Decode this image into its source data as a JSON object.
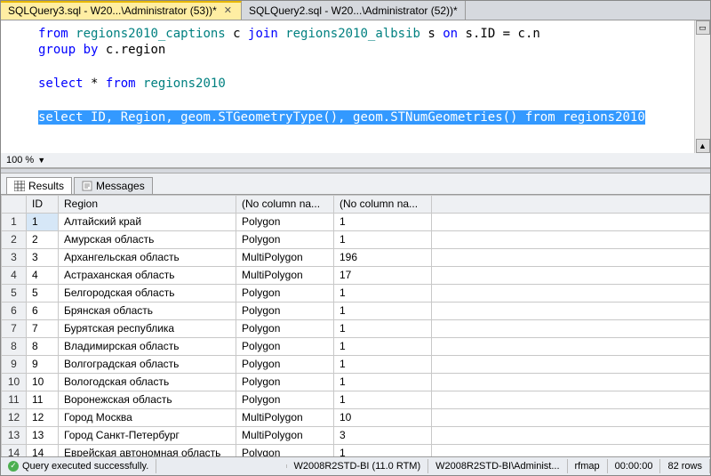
{
  "tabs": [
    {
      "label": "SQLQuery3.sql - W20...\\Administrator (53))*",
      "active": true
    },
    {
      "label": "SQLQuery2.sql - W20...\\Administrator (52))*",
      "active": false
    }
  ],
  "editor": {
    "line1_from": "from",
    "line1_t1": "regions2010_captions",
    "line1_c": "c",
    "line1_join": "join",
    "line1_t2": "regions2010_albsib",
    "line1_s": "s",
    "line1_on": "on",
    "line1_rest": "s.ID = c.n",
    "line2_group": "group",
    "line2_by": "by",
    "line2_col": "c.region",
    "line4_select": "select",
    "line4_star": "*",
    "line4_from": "from",
    "line4_t": "regions2010",
    "line6_select": "select",
    "line6_cols": "ID, Region, geom.",
    "line6_fn1": "STGeometryType",
    "line6_p1": "(), geom.",
    "line6_fn2": "STNumGeometries",
    "line6_p2": "()",
    "line6_from": "from",
    "line6_t": "regions2010"
  },
  "zoom": {
    "value": "100 %"
  },
  "result_tabs": {
    "results": "Results",
    "messages": "Messages"
  },
  "grid": {
    "headers": {
      "rownum": "",
      "id": "ID",
      "region": "Region",
      "c3": "(No column na...",
      "c4": "(No column na..."
    },
    "rows": [
      {
        "n": "1",
        "id": "1",
        "region": "Алтайский край",
        "geo": "Polygon",
        "num": "1"
      },
      {
        "n": "2",
        "id": "2",
        "region": "Амурская область",
        "geo": "Polygon",
        "num": "1"
      },
      {
        "n": "3",
        "id": "3",
        "region": "Архангельская область",
        "geo": "MultiPolygon",
        "num": "196"
      },
      {
        "n": "4",
        "id": "4",
        "region": "Астраханская область",
        "geo": "MultiPolygon",
        "num": "17"
      },
      {
        "n": "5",
        "id": "5",
        "region": "Белгородская область",
        "geo": "Polygon",
        "num": "1"
      },
      {
        "n": "6",
        "id": "6",
        "region": "Брянская область",
        "geo": "Polygon",
        "num": "1"
      },
      {
        "n": "7",
        "id": "7",
        "region": "Бурятская республика",
        "geo": "Polygon",
        "num": "1"
      },
      {
        "n": "8",
        "id": "8",
        "region": "Владимирская область",
        "geo": "Polygon",
        "num": "1"
      },
      {
        "n": "9",
        "id": "9",
        "region": "Волгоградская область",
        "geo": "Polygon",
        "num": "1"
      },
      {
        "n": "10",
        "id": "10",
        "region": "Вологодская область",
        "geo": "Polygon",
        "num": "1"
      },
      {
        "n": "11",
        "id": "11",
        "region": "Воронежская область",
        "geo": "Polygon",
        "num": "1"
      },
      {
        "n": "12",
        "id": "12",
        "region": "Город Москва",
        "geo": "MultiPolygon",
        "num": "10"
      },
      {
        "n": "13",
        "id": "13",
        "region": "Город Санкт-Петербург",
        "geo": "MultiPolygon",
        "num": "3"
      },
      {
        "n": "14",
        "id": "14",
        "region": "Еврейская автономная область",
        "geo": "Polygon",
        "num": "1"
      }
    ]
  },
  "status": {
    "ok": "Query executed successfully.",
    "server": "W2008R2STD-BI (11.0 RTM)",
    "user": "W2008R2STD-BI\\Administ...",
    "db": "rfmap",
    "time": "00:00:00",
    "rows": "82 rows"
  }
}
